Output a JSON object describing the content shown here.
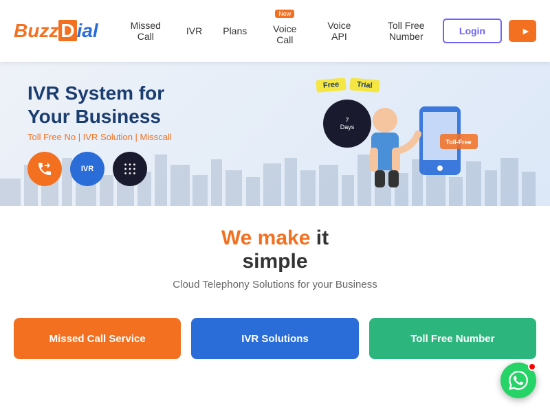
{
  "header": {
    "logo": {
      "buzz": "Buzz",
      "d": "D",
      "ial": "ial"
    },
    "nav": [
      {
        "label": "Missed Call",
        "id": "missed-call",
        "badge": null
      },
      {
        "label": "IVR",
        "id": "ivr",
        "badge": null
      },
      {
        "label": "Plans",
        "id": "plans",
        "badge": null
      },
      {
        "label": "Voice Call",
        "id": "voice-call",
        "badge": "New"
      },
      {
        "label": "Voice API",
        "id": "voice-api",
        "badge": null
      },
      {
        "label": "Toll Free Number",
        "id": "toll-free",
        "badge": null
      }
    ],
    "login_label": "Login",
    "signup_label": "►"
  },
  "hero": {
    "title_line1": "IVR System for",
    "title_line2": "Your Business",
    "subtitle": "Toll Free No | IVR Solution | Misscall",
    "free_label": "Free",
    "days_number": "7",
    "days_sub": "Days",
    "trial_label": "Trial"
  },
  "section": {
    "heading_orange": "We make",
    "heading_rest": " it\nsimple",
    "subtext": "Cloud Telephony Solutions for your Business"
  },
  "cards": [
    {
      "label": "Missed Call Service",
      "color": "card-orange"
    },
    {
      "label": "IVR Solutions",
      "color": "card-blue"
    },
    {
      "label": "Toll Free Number",
      "color": "card-green"
    }
  ],
  "whatsapp": {
    "aria": "WhatsApp chat"
  }
}
